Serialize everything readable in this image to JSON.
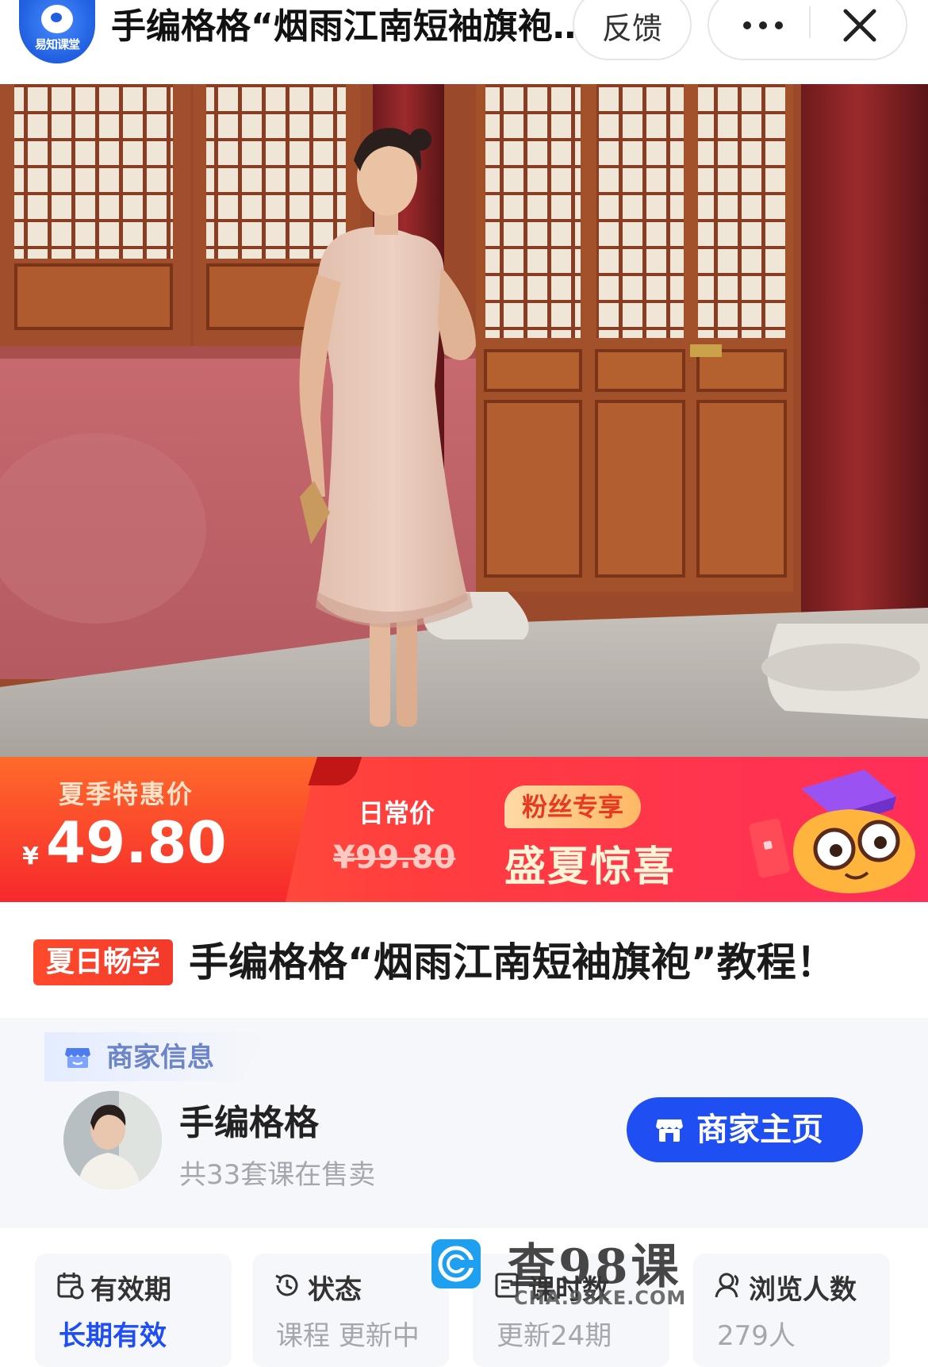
{
  "topbar": {
    "app_logo_text": "易知课堂",
    "title": "手编格格“烟雨江南短袖旗袍”教程！",
    "feedback_label": "反馈"
  },
  "promo": {
    "sale_label": "夏季特惠价",
    "currency": "¥",
    "sale_price": "49.80",
    "regular_label": "日常价",
    "regular_price": "¥99.80",
    "fan_badge": "粉丝专享",
    "headline": "盛夏惊喜"
  },
  "course": {
    "tag": "夏日畅学",
    "title": "手编格格“烟雨江南短袖旗袍”教程！"
  },
  "merchant": {
    "section_label": "商家信息",
    "name": "手编格格",
    "course_count": "共33套课在售卖",
    "home_button": "商家主页"
  },
  "info": [
    {
      "label": "有效期",
      "value": "长期有效",
      "icon": "calendar-icon"
    },
    {
      "label": "状态",
      "value": "课程 更新中",
      "icon": "clock-icon"
    },
    {
      "label": "课时数",
      "value": "更新24期",
      "icon": "document-icon"
    },
    {
      "label": "浏览人数",
      "value": "279人",
      "icon": "user-icon"
    }
  ],
  "watermark": {
    "text": "查98课",
    "url": "CHA.98KE.COM"
  },
  "colors": {
    "accent_blue": "#1f4ff3",
    "promo_red": "#f7282d",
    "muted_text": "#a4a7ae"
  }
}
